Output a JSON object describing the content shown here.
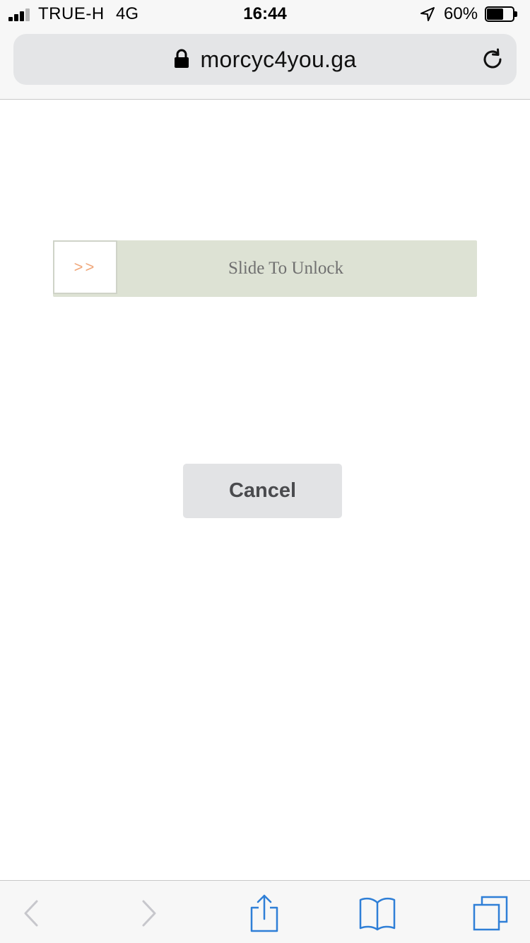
{
  "status_bar": {
    "carrier": "TRUE-H",
    "network": "4G",
    "time": "16:44",
    "battery_percent": "60%",
    "battery_level": 0.6,
    "signal_bars": 3
  },
  "browser": {
    "url": "morcyc4you.ga"
  },
  "slider": {
    "handle_label": ">>",
    "label": "Slide To Unlock",
    "track_color": "#dde2d4",
    "arrow_color": "#f0a77a"
  },
  "cancel": {
    "label": "Cancel"
  },
  "toolbar": {
    "items": [
      {
        "icon": "back-chevron-icon",
        "enabled": false
      },
      {
        "icon": "forward-chevron-icon",
        "enabled": false
      },
      {
        "icon": "share-icon",
        "enabled": true
      },
      {
        "icon": "bookmarks-icon",
        "enabled": true
      },
      {
        "icon": "tabs-icon",
        "enabled": true
      }
    ],
    "accent_color": "#2f7fd7",
    "disabled_color": "#c7c7cc"
  }
}
